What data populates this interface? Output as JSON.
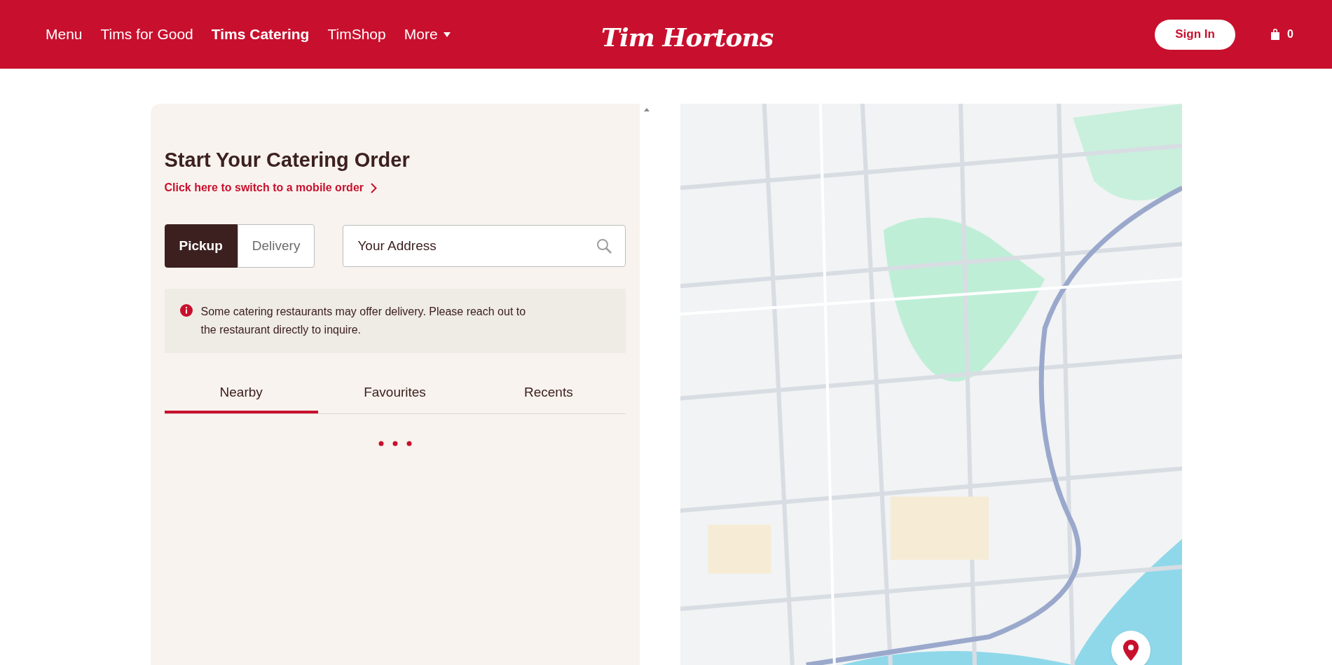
{
  "header": {
    "nav": [
      {
        "label": "Menu",
        "selected": false,
        "kind": "link"
      },
      {
        "label": "Tims for Good",
        "selected": false,
        "kind": "link"
      },
      {
        "label": "Tims Catering",
        "selected": true,
        "kind": "link"
      },
      {
        "label": "TimShop",
        "selected": false,
        "kind": "link"
      },
      {
        "label": "More",
        "selected": false,
        "kind": "dropdown"
      }
    ],
    "logo": "Tim Hortons",
    "sign_in": "Sign In",
    "cart_count": "0"
  },
  "order": {
    "title": "Start Your Catering Order",
    "switch_link": "Click here to switch to a mobile order",
    "modes": [
      {
        "label": "Pickup",
        "selected": true
      },
      {
        "label": "Delivery",
        "selected": false
      }
    ],
    "address": {
      "placeholder": "Your Address"
    },
    "notice": "Some catering restaurants may offer delivery. Please reach out to the restaurant directly to inquire.",
    "tabs": [
      {
        "label": "Nearby",
        "selected": true
      },
      {
        "label": "Favourites",
        "selected": false
      },
      {
        "label": "Recents",
        "selected": false
      }
    ],
    "loading": true
  }
}
